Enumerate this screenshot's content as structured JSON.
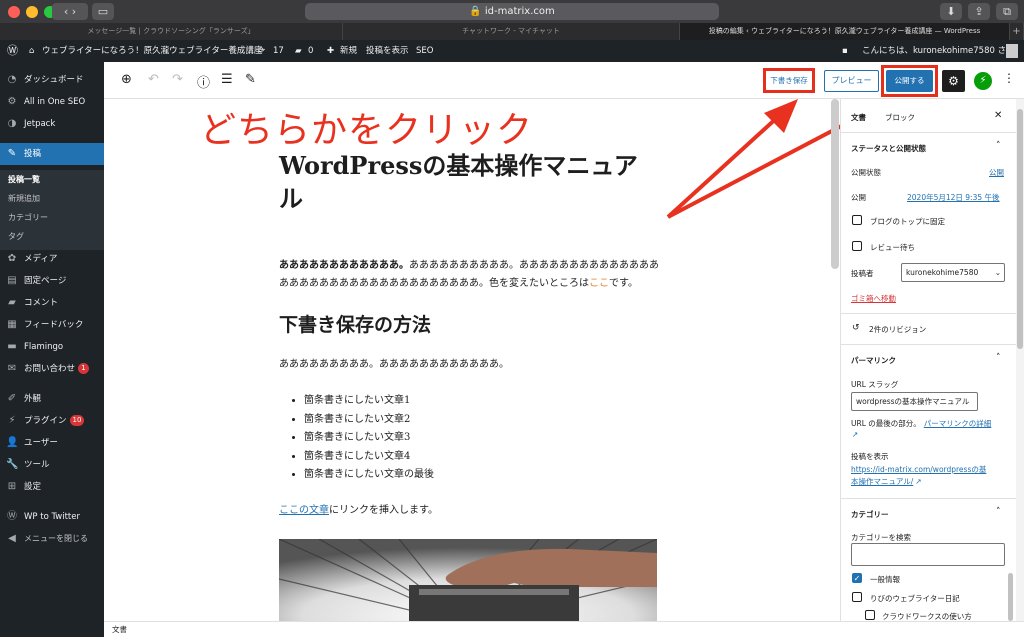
{
  "browser": {
    "url": "id-matrix.com",
    "tabs": [
      "メッセージ一覧 | クラウドソーシング「ランサーズ」",
      "チャットワーク - マイチャット",
      "投稿の編集 ‹ ウェブライターになろう！原久瀧ウェブライター養成講座 — WordPress"
    ]
  },
  "adminbar": {
    "site_name": "ウェブライターになろう！原久瀧ウェブライター養成講座",
    "updates_count": "17",
    "comments_count": "0",
    "new_label": "新規",
    "view_post": "投稿を表示",
    "seo": "SEO",
    "greeting": "こんにちは、kuronekohime7580 さん"
  },
  "sidebar": {
    "items": [
      {
        "label": "ダッシュボード",
        "icon": "dashboard-icon"
      },
      {
        "label": "All in One SEO",
        "icon": "seo-icon"
      },
      {
        "label": "Jetpack",
        "icon": "jetpack-icon"
      },
      {
        "label": "投稿",
        "icon": "pin-icon"
      },
      {
        "label": "メディア",
        "icon": "media-icon"
      },
      {
        "label": "固定ページ",
        "icon": "page-icon"
      },
      {
        "label": "コメント",
        "icon": "comment-icon"
      },
      {
        "label": "フィードバック",
        "icon": "feedback-icon"
      },
      {
        "label": "Flamingo",
        "icon": "flamingo-icon"
      },
      {
        "label": "お問い合わせ",
        "icon": "mail-icon",
        "badge": "1"
      },
      {
        "label": "外観",
        "icon": "brush-icon"
      },
      {
        "label": "プラグイン",
        "icon": "plugin-icon",
        "badge": "10"
      },
      {
        "label": "ユーザー",
        "icon": "user-icon"
      },
      {
        "label": "ツール",
        "icon": "wrench-icon"
      },
      {
        "label": "設定",
        "icon": "settings-icon"
      },
      {
        "label": "WP to Twitter",
        "icon": "wp-icon"
      },
      {
        "label": "メニューを閉じる",
        "icon": "collapse-icon"
      }
    ],
    "submenu": [
      "投稿一覧",
      "新規追加",
      "カテゴリー",
      "タグ"
    ]
  },
  "toolbar": {
    "save_draft": "下書き保存",
    "preview": "プレビュー",
    "publish": "公開する"
  },
  "post": {
    "title": "WordPressの基本操作マニュアル",
    "annotation": "どちらかをクリック",
    "para1_bold": "ああああああああああああ。",
    "para1_rest": "ああああああああああ。ああああああああああああああああああああああああああああああああああ。色を変えたいところは",
    "para1_highlight": "ここ",
    "para1_end": "です。",
    "heading2": "下書き保存の方法",
    "para2": "あああああああああ。ああああああああああああ。",
    "bullets": [
      "箇条書きにしたい文章1",
      "箇条書きにしたい文章2",
      "箇条書きにしたい文章3",
      "箇条書きにしたい文章4",
      "箇条書きにしたい文章の最後"
    ],
    "link_text": "ここの文章",
    "link_rest": "にリンクを挿入します。"
  },
  "settings_panel": {
    "tab_post": "文書",
    "tab_block": "ブロック",
    "status_section": "ステータスと公開状態",
    "visibility_label": "公開状態",
    "visibility_value": "公開",
    "publish_label": "公開",
    "publish_value": "2020年5月12日 9:35 午後",
    "sticky": "ブログのトップに固定",
    "pending": "レビュー待ち",
    "author_label": "投稿者",
    "author_value": "kuronekohime7580",
    "trash": "ゴミ箱へ移動",
    "revisions": "2件のリビジョン",
    "permalink_section": "パーマリンク",
    "url_slug_label": "URL スラッグ",
    "url_slug_value": "wordpressの基本操作マニュアル",
    "url_note": "URL の最後の部分。",
    "permalink_more": "パーマリンクの詳細",
    "view_post_label": "投稿を表示",
    "view_post_url_1": "https://id-matrix.com/wordpressの基",
    "view_post_url_2": "本操作マニュアル/",
    "category_section": "カテゴリー",
    "category_search": "カテゴリーを検索",
    "categories": [
      "一般情報",
      "りびのウェブライター日記",
      "クラウドワークスの使い方"
    ]
  },
  "footer": {
    "breadcrumb": "文書"
  },
  "colors": {
    "accent": "#2271b1",
    "annotation_red": "#e8321f",
    "admin_dark": "#1d2327"
  }
}
